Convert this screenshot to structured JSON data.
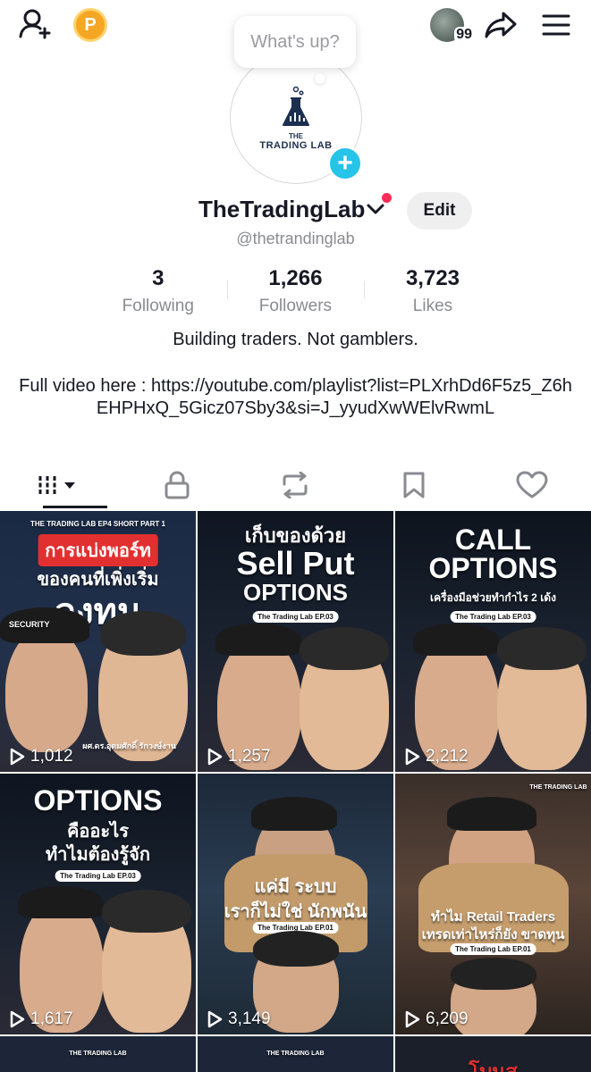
{
  "topbar": {
    "add_user_icon": "add-user-icon",
    "coin_label": "P",
    "notification_count": "99",
    "share_icon": "share-icon",
    "menu_icon": "menu-icon"
  },
  "bubble": {
    "text": "What's up?"
  },
  "avatar": {
    "brand_small": "THE",
    "brand_main": "TRADING LAB",
    "add_label": "+"
  },
  "profile": {
    "username": "TheTradingLab",
    "edit_label": "Edit",
    "handle": "@thetrandinglab",
    "bio": "Building traders. Not gamblers.",
    "link_text": "Full video here : https://youtube.com/playlist?list=PLXrhDd6F5z5_Z6hEHPHxQ_5Gicz07Sby3&si=J_yyudXwWElvRwmL"
  },
  "stats": [
    {
      "value": "3",
      "label": "Following"
    },
    {
      "value": "1,266",
      "label": "Followers"
    },
    {
      "value": "3,723",
      "label": "Likes"
    }
  ],
  "tabs": [
    {
      "name": "videos",
      "icon": "grid-icon"
    },
    {
      "name": "private",
      "icon": "lock-icon"
    },
    {
      "name": "reposts",
      "icon": "repost-icon"
    },
    {
      "name": "favorites",
      "icon": "bookmark-icon"
    },
    {
      "name": "liked",
      "icon": "heart-icon"
    }
  ],
  "videos": [
    {
      "top_text": "THE TRADING LAB EP4 SHORT PART 1",
      "title": "การแบ่งพอร์ท",
      "subtitle": "ของคนที่เพิ่งเริ่ม",
      "big": "ลงทุน",
      "caption": "ผศ.ดร.อุดมศักดิ์ รักวงษ์งาน",
      "cap_label": "SECURITY",
      "views": "1,012"
    },
    {
      "top_text": "เก็บของด้วย",
      "title": "Sell Put",
      "subtitle": "OPTIONS",
      "badge": "The Trading Lab EP.03",
      "views": "1,257"
    },
    {
      "title": "CALL",
      "subtitle": "OPTIONS",
      "small": "เครื่องมือช่วยทำกำไร 2 เด้ง",
      "badge": "The Trading Lab EP.03",
      "views": "2,212"
    },
    {
      "title": "OPTIONS",
      "subtitle": "คืออะไร",
      "small": "ทำไมต้องรู้จัก",
      "badge": "The Trading Lab EP.03",
      "views": "1,617"
    },
    {
      "title": "แค่มี ระบบ",
      "subtitle": "เราก็ไม่ใช่ นักพนัน",
      "badge": "The Trading Lab EP.01",
      "views": "3,149"
    },
    {
      "title": "ทำไม Retail Traders",
      "subtitle": "เทรดเท่าไหร่ก็ยัง ขาดทุน",
      "badge": "The Trading Lab EP.01",
      "brand": "THE TRADING LAB",
      "views": "6,209"
    }
  ],
  "partial_row": [
    {
      "text": "THE TRADING LAB"
    },
    {
      "text": "THE TRADING LAB"
    },
    {
      "text": "โบนุส"
    }
  ]
}
